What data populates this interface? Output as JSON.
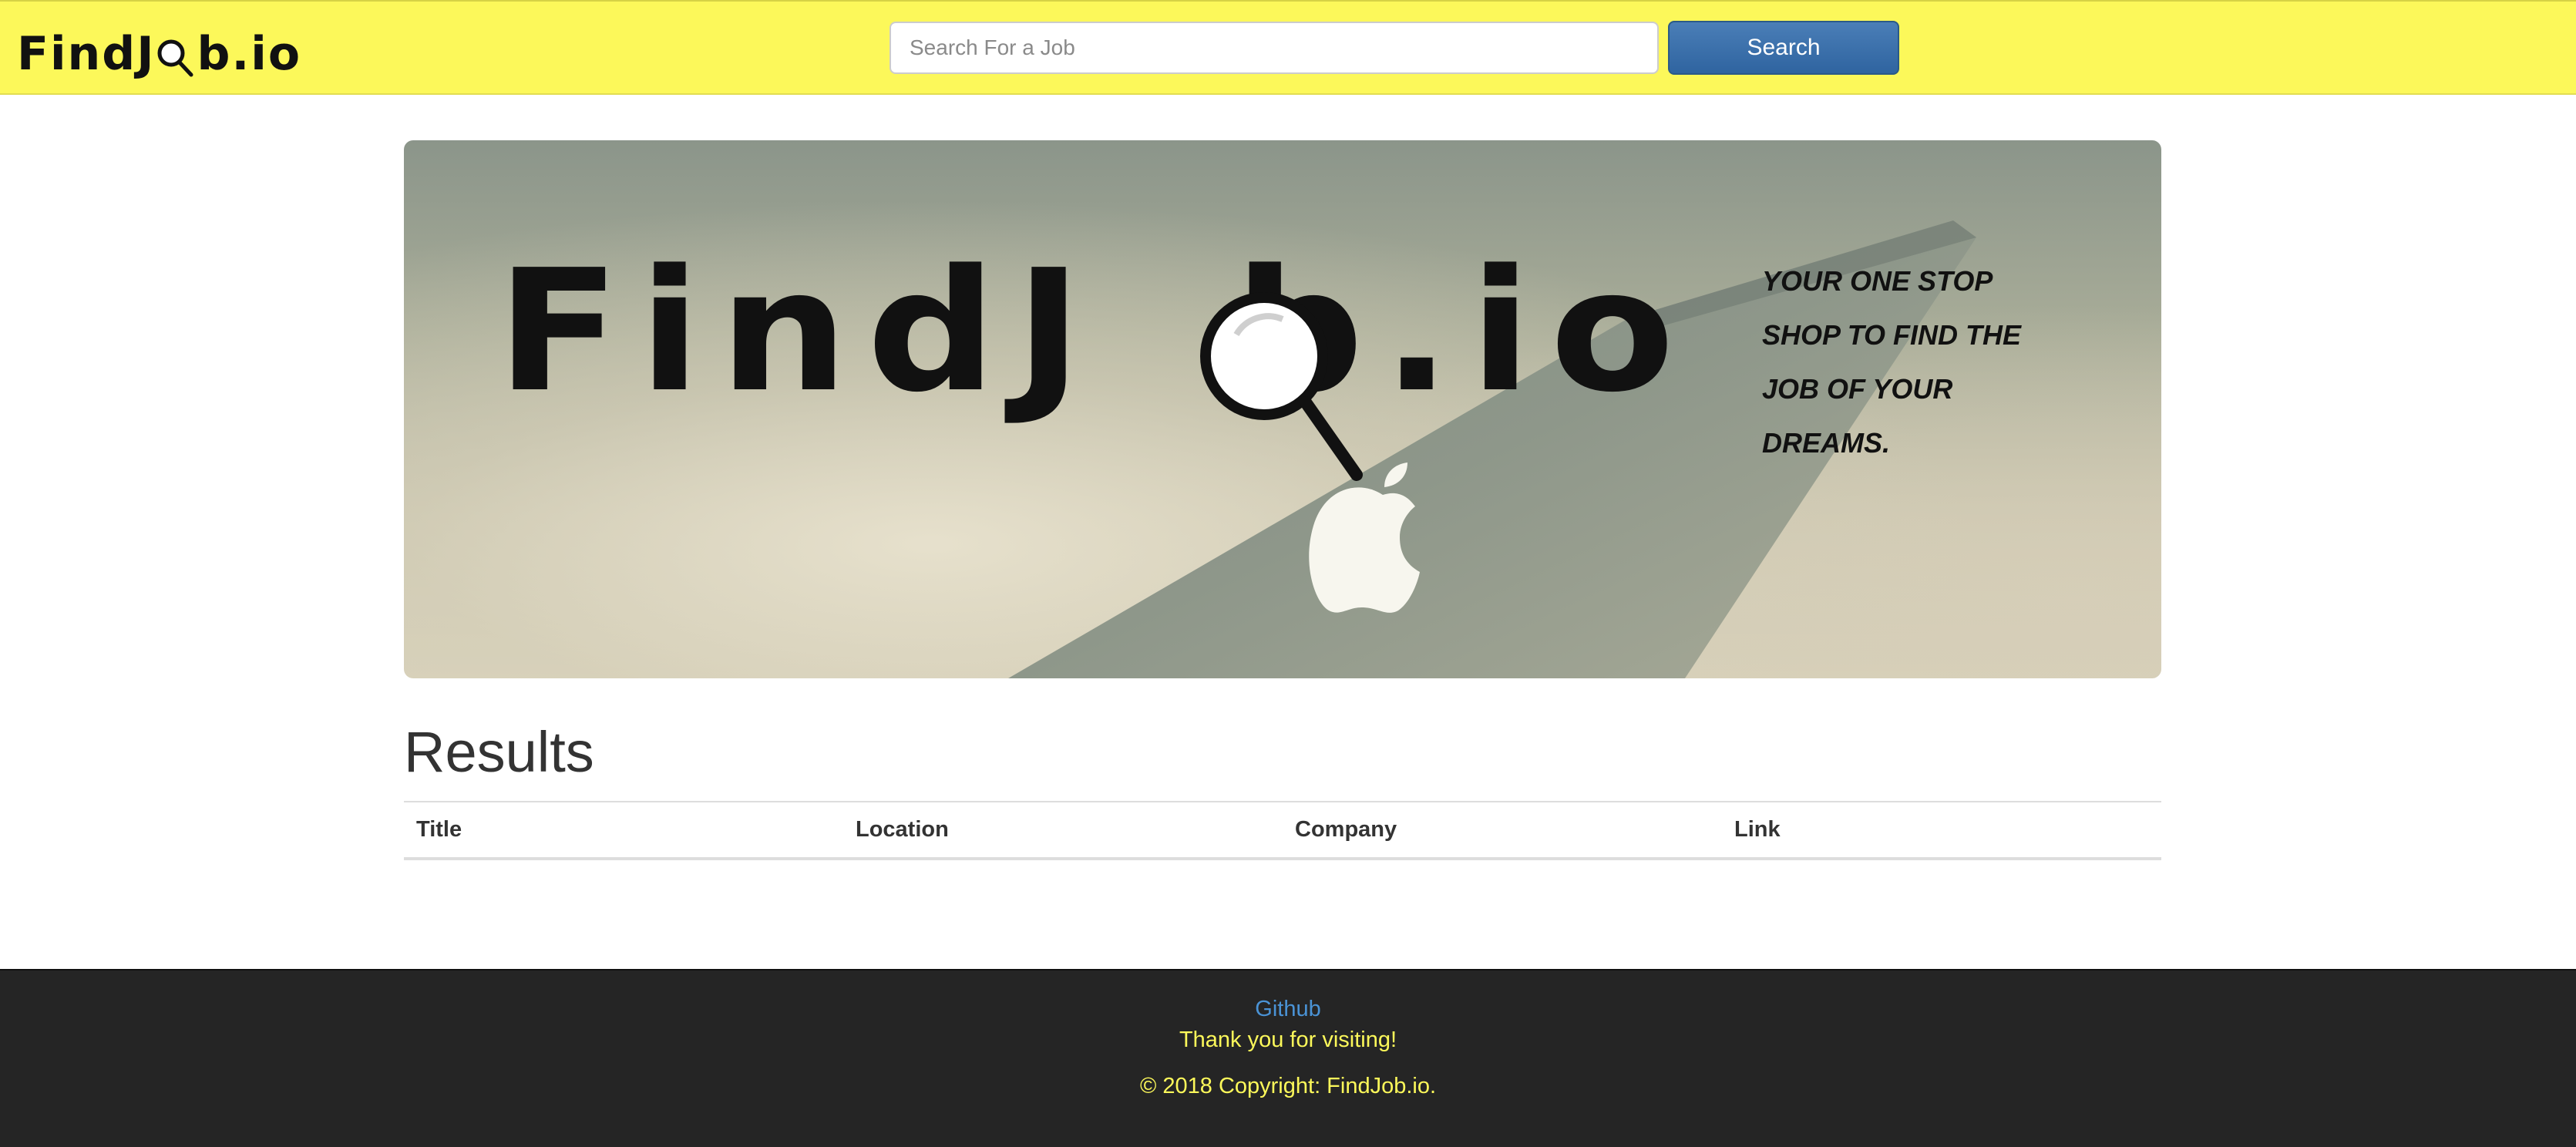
{
  "navbar": {
    "brand_prefix": "FindJ",
    "brand_suffix": "b.io",
    "search": {
      "placeholder": "Search For a Job",
      "value": ""
    },
    "search_button_label": "Search",
    "colors": {
      "background": "#fcf85a",
      "button": "#3a6fa8"
    }
  },
  "hero": {
    "title_prefix": "FindJ",
    "title_suffix": "b.io",
    "tagline": "YOUR ONE STOP SHOP TO FIND THE JOB OF YOUR DREAMS.",
    "background_icon": "apple-logo-icon"
  },
  "results": {
    "heading": "Results",
    "columns": [
      "Title",
      "Location",
      "Company",
      "Link"
    ],
    "rows": []
  },
  "footer": {
    "link_label": "Github",
    "thanks": "Thank you for visiting!",
    "copyright": "© 2018 Copyright: FindJob.io.",
    "colors": {
      "background": "#252525",
      "text": "#fcf85a",
      "link": "#4a93d6"
    }
  }
}
